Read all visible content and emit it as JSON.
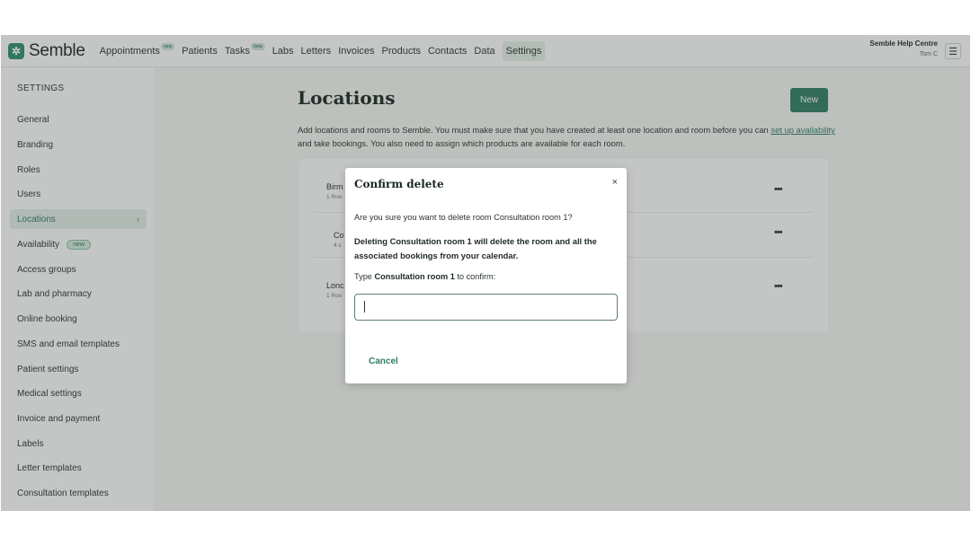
{
  "brand": {
    "name": "Semble",
    "icon": "semble-logo-icon"
  },
  "nav": {
    "items": [
      {
        "label": "Appointments",
        "tag": "new"
      },
      {
        "label": "Patients",
        "tag": ""
      },
      {
        "label": "Tasks",
        "tag": "beta"
      },
      {
        "label": "Labs",
        "tag": ""
      },
      {
        "label": "Letters",
        "tag": ""
      },
      {
        "label": "Invoices",
        "tag": ""
      },
      {
        "label": "Products",
        "tag": ""
      },
      {
        "label": "Contacts",
        "tag": ""
      },
      {
        "label": "Data",
        "tag": ""
      },
      {
        "label": "Settings",
        "tag": ""
      }
    ],
    "active": "Settings",
    "help_centre": "Semble Help Centre",
    "user": "Tom C",
    "menu_icon": "hamburger-menu-icon"
  },
  "sidebar": {
    "heading": "SETTINGS",
    "items": [
      {
        "label": "General"
      },
      {
        "label": "Branding"
      },
      {
        "label": "Roles"
      },
      {
        "label": "Users"
      },
      {
        "label": "Locations"
      },
      {
        "label": "Availability",
        "badge": "new"
      },
      {
        "label": "Access groups"
      },
      {
        "label": "Lab and pharmacy"
      },
      {
        "label": "Online booking"
      },
      {
        "label": "SMS and email templates"
      },
      {
        "label": "Patient settings"
      },
      {
        "label": "Medical settings"
      },
      {
        "label": "Invoice and payment"
      },
      {
        "label": "Labels"
      },
      {
        "label": "Letter templates"
      },
      {
        "label": "Consultation templates"
      }
    ],
    "active": "Locations",
    "chevron": "›"
  },
  "main": {
    "title": "Locations",
    "new_button": "New",
    "description_before": "Add locations and rooms to Semble. You must make sure that you have created at least one location and room before you can",
    "description_link": "set up availability",
    "description_after": "and take bookings. You also need to assign which products are available for each room.",
    "locations": [
      {
        "name": "Birm",
        "sub": "1 Roo"
      },
      {
        "name": "Co",
        "sub": "4 s"
      },
      {
        "name": "Lonc",
        "sub": "1 Roo"
      }
    ],
    "more_label": "•••"
  },
  "modal": {
    "title": "Confirm delete",
    "close": "×",
    "question": "Are you sure you want to delete room Consultation room 1?",
    "warning": "Deleting Consultation room 1 will delete the room and all the associated bookings from your calendar.",
    "type_prefix": "Type",
    "type_target": "Consultation room 1",
    "type_suffix": "to confirm:",
    "input_value": "",
    "cancel": "Cancel"
  }
}
